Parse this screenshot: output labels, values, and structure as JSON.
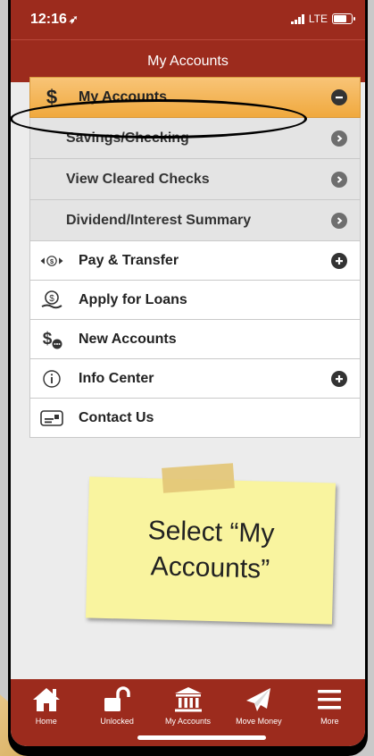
{
  "status": {
    "time": "12:16",
    "network": "LTE"
  },
  "nav": {
    "title": "My Accounts"
  },
  "menu": {
    "my_accounts": {
      "label": "My Accounts",
      "icon": "dollar-icon",
      "children": [
        {
          "label": "Savings/Checking"
        },
        {
          "label": "View Cleared Checks"
        },
        {
          "label": "Dividend/Interest Summary"
        }
      ]
    },
    "pay_transfer": {
      "label": "Pay & Transfer",
      "icon": "money-transfer-icon"
    },
    "apply_loans": {
      "label": "Apply for Loans",
      "icon": "loan-hand-icon"
    },
    "new_accounts": {
      "label": "New Accounts",
      "icon": "new-account-icon"
    },
    "info_center": {
      "label": "Info Center",
      "icon": "info-icon"
    },
    "contact_us": {
      "label": "Contact Us",
      "icon": "contact-card-icon"
    }
  },
  "note": {
    "line1": "Select “My",
    "line2": "Accounts”"
  },
  "tabs": [
    {
      "label": "Home",
      "icon": "home-icon"
    },
    {
      "label": "Unlocked",
      "icon": "unlock-icon"
    },
    {
      "label": "My Accounts",
      "icon": "bank-icon"
    },
    {
      "label": "Move Money",
      "icon": "paper-plane-icon"
    },
    {
      "label": "More",
      "icon": "menu-icon"
    }
  ],
  "colors": {
    "brand": "#9c2b1d",
    "header_gold": "#f0a93e",
    "sticky_note": "#f9f49f"
  }
}
